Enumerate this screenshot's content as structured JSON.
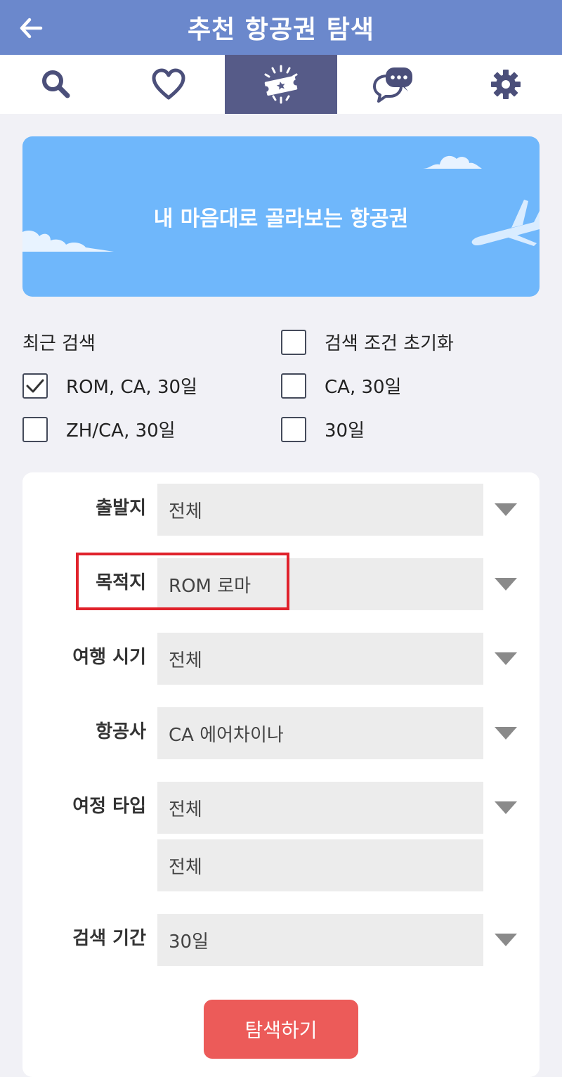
{
  "header": {
    "title": "추천 항공권 탐색",
    "back_icon": "arrow-left-icon",
    "color": "#6b88cc"
  },
  "tabs": [
    {
      "icon": "search-icon",
      "active": false
    },
    {
      "icon": "heart-icon",
      "active": false
    },
    {
      "icon": "ticket-icon",
      "active": true
    },
    {
      "icon": "chat-icon",
      "active": false
    },
    {
      "icon": "gear-icon",
      "active": false
    }
  ],
  "banner": {
    "text": "내 마음대로 골라보는 항공권",
    "color": "#6fb7fb"
  },
  "recent": {
    "label": "최근 검색",
    "reset_label": "검색 조건 초기화",
    "items": [
      {
        "label": "ROM, CA, 30일",
        "checked": true
      },
      {
        "label": "CA, 30일",
        "checked": false
      },
      {
        "label": "ZH/CA, 30일",
        "checked": false
      },
      {
        "label": "30일",
        "checked": false
      }
    ]
  },
  "form": {
    "departure": {
      "label": "출발지",
      "value": "전체"
    },
    "destination": {
      "label": "목적지",
      "value": "ROM 로마"
    },
    "travel_period": {
      "label": "여행 시기",
      "value": "전체"
    },
    "airline": {
      "label": "항공사",
      "value": "CA 에어차이나"
    },
    "trip_type": {
      "label": "여정 타입",
      "value": "전체",
      "value2": "전체"
    },
    "search_period": {
      "label": "검색 기간",
      "value": "30일"
    }
  },
  "search_button": {
    "label": "탐색하기",
    "color": "#ec5b59"
  }
}
